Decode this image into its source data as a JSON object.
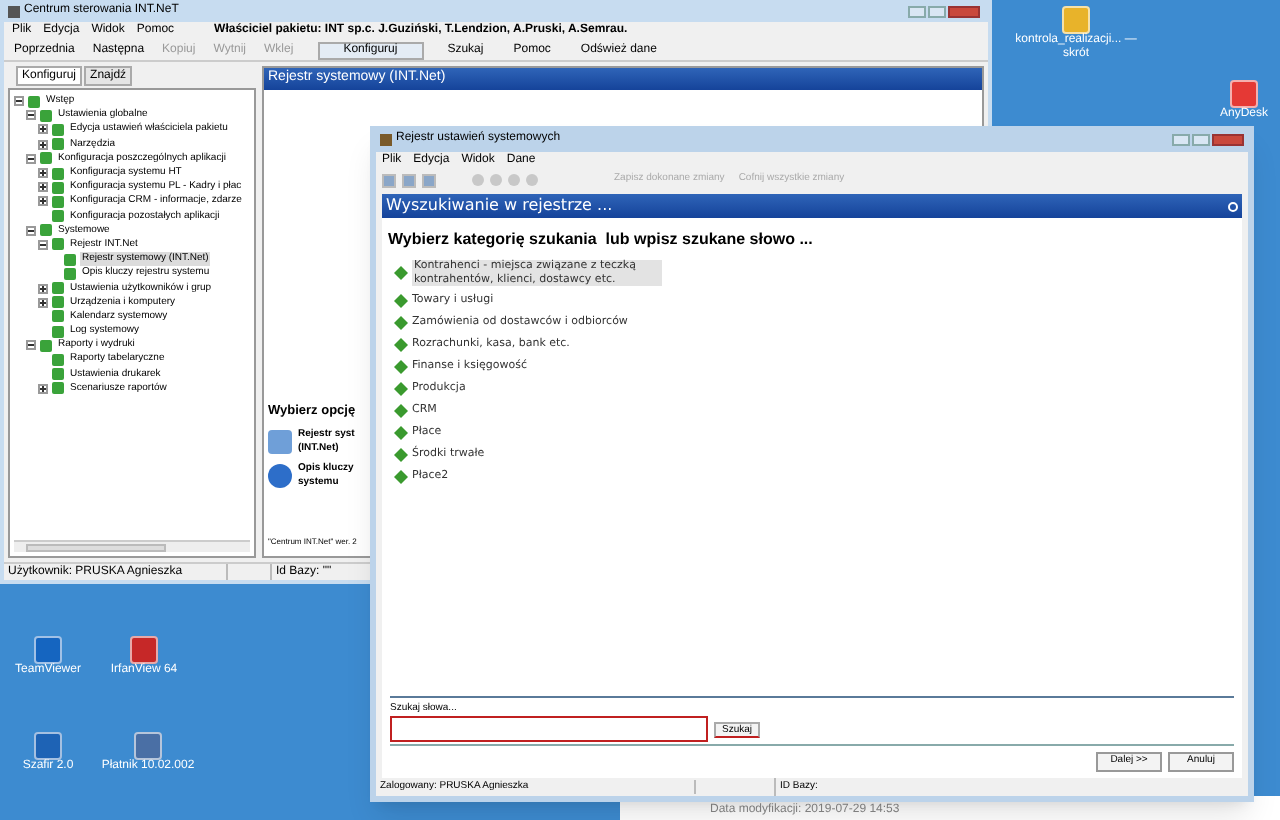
{
  "desktop_icons": [
    {
      "label": "kontrola_realizacji... — skrót",
      "kind": "browser"
    },
    {
      "label": "AnyDesk",
      "kind": "anydesk"
    },
    {
      "label": "TeamViewer",
      "kind": "teamviewer"
    },
    {
      "label": "IrfanView 64",
      "kind": "irfanview"
    },
    {
      "label": "Szafir 2.0",
      "kind": "szafir"
    },
    {
      "label": "Płatnik 10.02.002",
      "kind": "platnik"
    }
  ],
  "background_window": {
    "text": "Data modyfikacji: 2019-07-29 14:53"
  },
  "main_window": {
    "title": "Centrum sterowania INT.NeT",
    "menu": [
      "Plik",
      "Edycja",
      "Widok",
      "Pomoc"
    ],
    "owner": "Właściciel pakietu: INT sp.c. J.Guziński, T.Lendzion, A.Pruski, A.Semrau.",
    "toolbar": [
      {
        "label": "Poprzednia",
        "disabled": false,
        "selected": false
      },
      {
        "label": "Następna",
        "disabled": false,
        "selected": false
      },
      {
        "label": "Kopiuj",
        "disabled": true,
        "selected": false
      },
      {
        "label": "Wytnij",
        "disabled": true,
        "selected": false
      },
      {
        "label": "Wklej",
        "disabled": true,
        "selected": false
      },
      {
        "label": "Konfiguruj",
        "disabled": false,
        "selected": true
      },
      {
        "label": "Szukaj",
        "disabled": false,
        "selected": false
      },
      {
        "label": "Pomoc",
        "disabled": false,
        "selected": false
      },
      {
        "label": "Odśwież dane",
        "disabled": false,
        "selected": false
      }
    ],
    "tabs": [
      {
        "label": "Konfiguruj",
        "selected": true
      },
      {
        "label": "Znajdź",
        "selected": false
      }
    ],
    "tree": [
      {
        "label": "Wstęp",
        "expanded": true,
        "selected": false,
        "children": [
          {
            "label": "Ustawienia globalne",
            "expanded": true,
            "selected": false,
            "children": [
              {
                "label": "Edycja ustawień właściciela pakietu",
                "expanded": false,
                "selected": false
              },
              {
                "label": "Narzędzia",
                "expanded": false,
                "selected": false
              }
            ]
          },
          {
            "label": "Konfiguracja poszczególnych aplikacji",
            "expanded": true,
            "selected": false,
            "children": [
              {
                "label": "Konfiguracja systemu HT",
                "expanded": false,
                "selected": false
              },
              {
                "label": "Konfiguracja systemu PL - Kadry i płac",
                "expanded": false,
                "selected": false
              },
              {
                "label": "Konfiguracja CRM - informacje, zdarze",
                "expanded": false,
                "selected": false
              },
              {
                "label": "Konfiguracja pozostałych aplikacji",
                "selected": false
              }
            ]
          },
          {
            "label": "Systemowe",
            "expanded": true,
            "selected": false,
            "children": [
              {
                "label": "Rejestr INT.Net",
                "expanded": true,
                "selected": false,
                "children": [
                  {
                    "label": "Rejestr systemowy (INT.Net)",
                    "selected": true
                  },
                  {
                    "label": "Opis kluczy rejestru systemu",
                    "selected": false
                  }
                ]
              },
              {
                "label": "Ustawienia użytkowników i grup",
                "expanded": false,
                "selected": false
              },
              {
                "label": "Urządzenia i komputery",
                "expanded": false,
                "selected": false
              },
              {
                "label": "Kalendarz systemowy",
                "selected": false
              },
              {
                "label": "Log systemowy",
                "selected": false
              }
            ]
          },
          {
            "label": "Raporty i wydruki",
            "expanded": true,
            "selected": false,
            "children": [
              {
                "label": "Raporty tabelaryczne",
                "selected": false
              },
              {
                "label": "Ustawienia drukarek",
                "selected": false
              },
              {
                "label": "Scenariusze raportów",
                "expanded": false,
                "selected": false
              }
            ]
          }
        ]
      }
    ],
    "panel_title": "Rejestr systemowy (INT.Net)",
    "options_heading": "Wybierz opcję",
    "options": [
      {
        "lines": [
          "Rejestr syst",
          "(INT.Net)"
        ],
        "kind": "registry"
      },
      {
        "lines": [
          "Opis kluczy",
          "systemu"
        ],
        "kind": "info"
      }
    ],
    "version": "\"Centrum INT.Net\" wer. 2",
    "status": [
      "Użytkownik: PRUSKA Agnieszka",
      "Id Bazy: \"\""
    ]
  },
  "dialog": {
    "title": "Rejestr ustawień systemowych",
    "menu": [
      "Plik",
      "Edycja",
      "Widok",
      "Dane"
    ],
    "toolbar_actions": [
      {
        "label": "Zapisz dokonane zmiany",
        "disabled": true
      },
      {
        "label": "Cofnij wszystkie zmiany",
        "disabled": true
      }
    ],
    "header": "Wyszukiwanie w rejestrze ...",
    "heading": "Wybierz kategorię szukania  lub wpisz szukane słowo ...",
    "categories": [
      {
        "label": "Kontrahenci - miejsca związane z teczką kontrahentów, klienci, dostawcy etc.",
        "selected": true
      },
      {
        "label": "Towary i usługi",
        "selected": false
      },
      {
        "label": "Zamówienia od dostawców i odbiorców",
        "selected": false
      },
      {
        "label": "Rozrachunki, kasa, bank etc.",
        "selected": false
      },
      {
        "label": "Finanse i księgowość",
        "selected": false
      },
      {
        "label": "Produkcja",
        "selected": false
      },
      {
        "label": "CRM",
        "selected": false
      },
      {
        "label": "Płace",
        "selected": false
      },
      {
        "label": "Środki trwałe",
        "selected": false
      },
      {
        "label": "Płace2",
        "selected": false
      }
    ],
    "search_label": "Szukaj słowa...",
    "search_button": "Szukaj",
    "buttons": [
      "Dalej >>",
      "Anuluj"
    ],
    "status": [
      "Zalogowany: PRUSKA Agnieszka",
      "ID Bazy:"
    ]
  }
}
